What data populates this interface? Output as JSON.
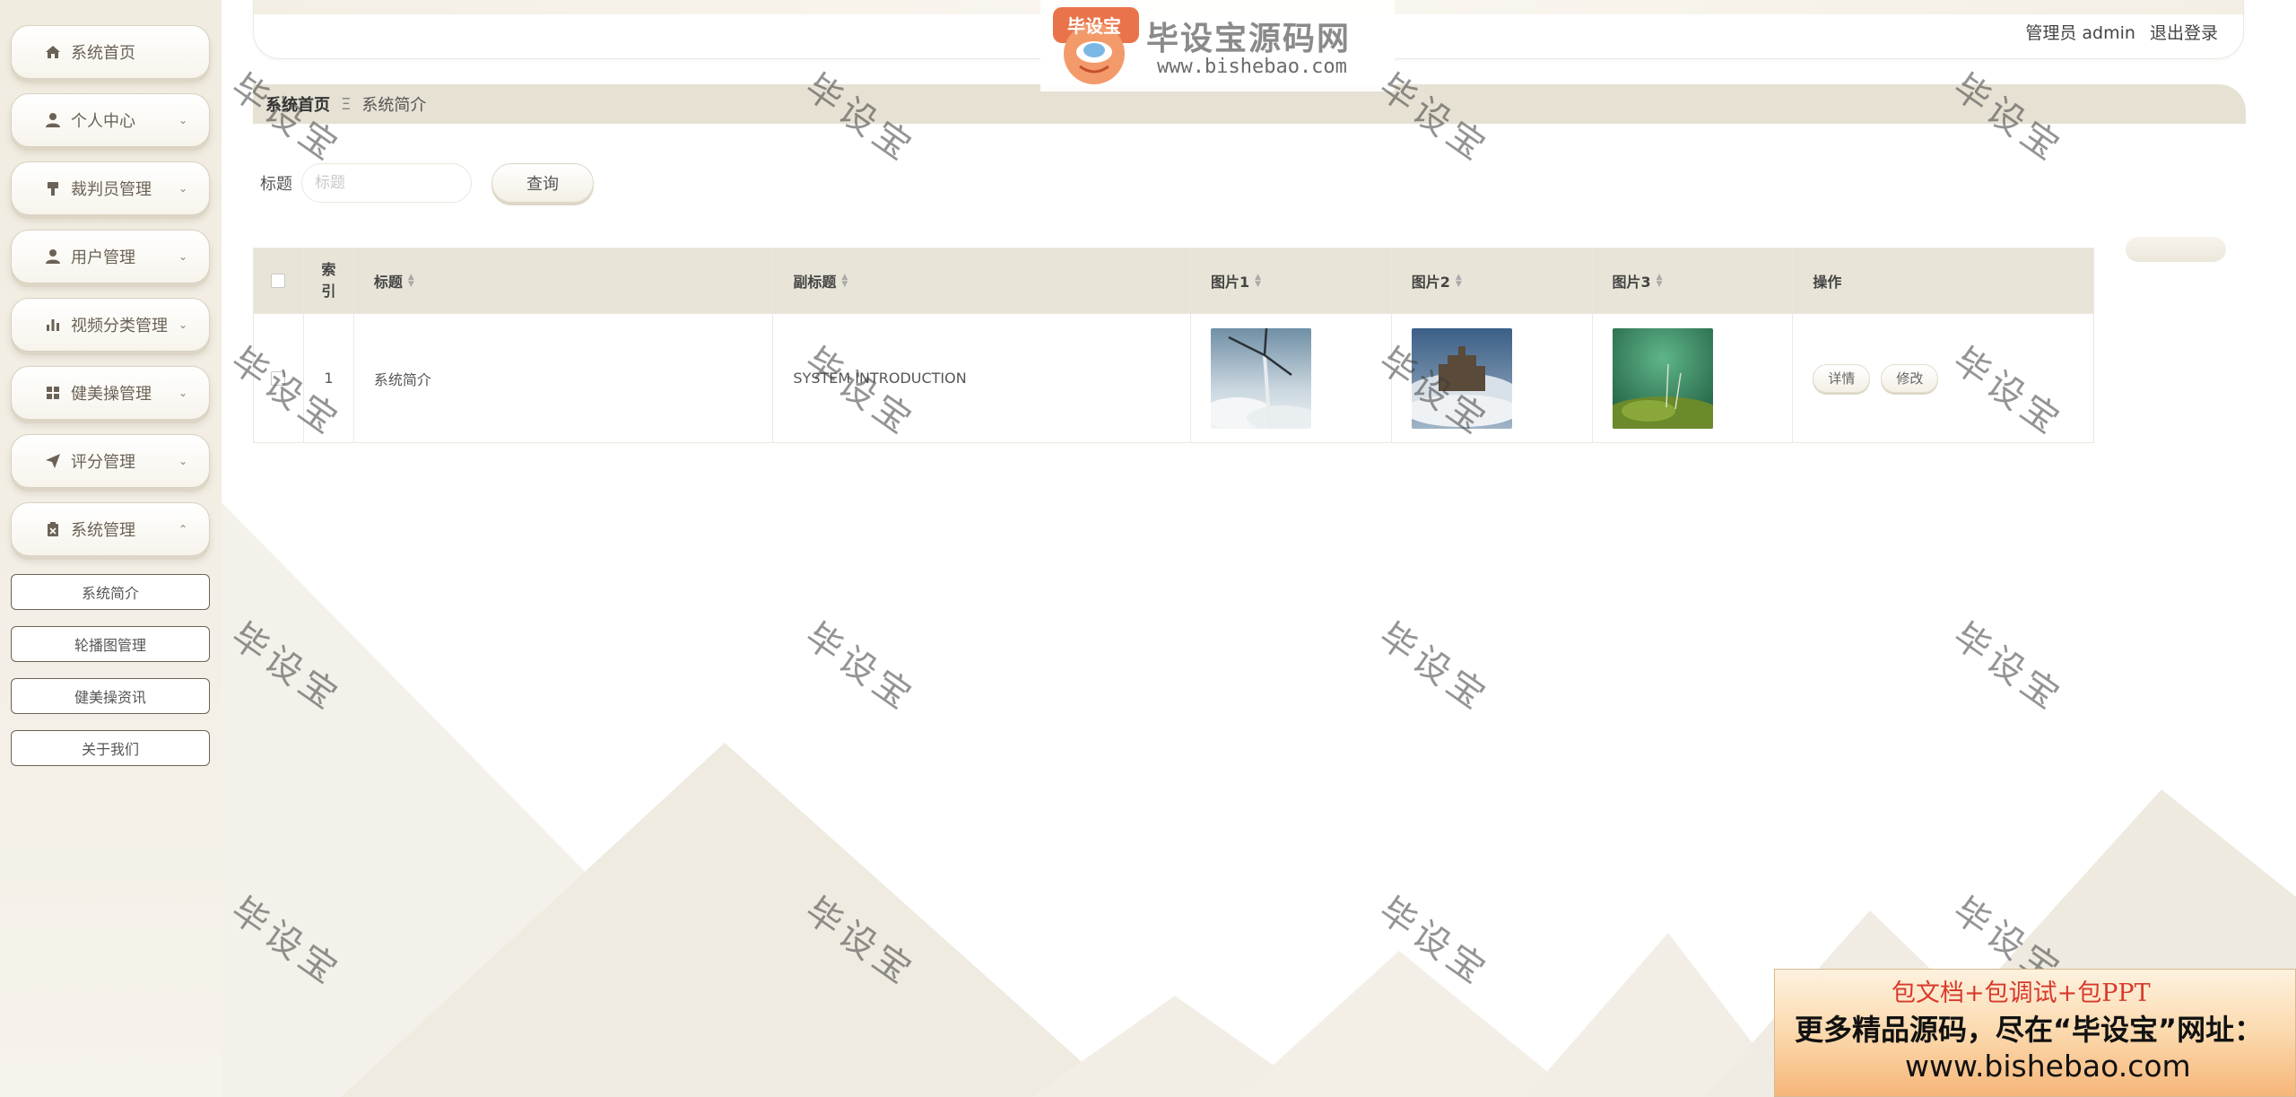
{
  "header": {
    "user_label": "管理员 admin",
    "logout_label": "退出登录"
  },
  "logo": {
    "badge": "毕设宝",
    "title": "毕设宝源码网",
    "url": "www.bishebao.com"
  },
  "sidebar": {
    "items": [
      {
        "label": "系统首页",
        "icon": "home-icon"
      },
      {
        "label": "个人中心",
        "icon": "user-icon"
      },
      {
        "label": "裁判员管理",
        "icon": "flag-icon"
      },
      {
        "label": "用户管理",
        "icon": "user-icon"
      },
      {
        "label": "视频分类管理",
        "icon": "bar-chart-icon"
      },
      {
        "label": "健美操管理",
        "icon": "grid-icon"
      },
      {
        "label": "评分管理",
        "icon": "send-icon"
      },
      {
        "label": "系统管理",
        "icon": "clipboard-icon"
      }
    ],
    "subitems": [
      "系统简介",
      "轮播图管理",
      "健美操资讯",
      "关于我们"
    ]
  },
  "breadcrumb": {
    "home": "系统首页",
    "separator": "Ξ",
    "current": "系统简介"
  },
  "search": {
    "label": "标题",
    "placeholder": "标题",
    "button": "查询"
  },
  "table": {
    "headers": [
      "索引",
      "标题",
      "副标题",
      "图片1",
      "图片2",
      "图片3",
      "操作"
    ],
    "rows": [
      {
        "index": "1",
        "title": "系统简介",
        "subtitle": "SYSTEM INTRODUCTION",
        "actions": [
          "详情",
          "修改"
        ]
      }
    ]
  },
  "watermark": "毕设宝",
  "ad": {
    "line1": "包文档+包调试+包PPT",
    "line2": "更多精品源码，尽在“毕设宝”网址：",
    "line3": "www.bishebao.com"
  },
  "colors": {
    "sidebar_bg": "#f1ece0",
    "table_header_bg": "#e8e4d7",
    "accent_text": "#6b6256",
    "ad_red": "#d8392b"
  }
}
